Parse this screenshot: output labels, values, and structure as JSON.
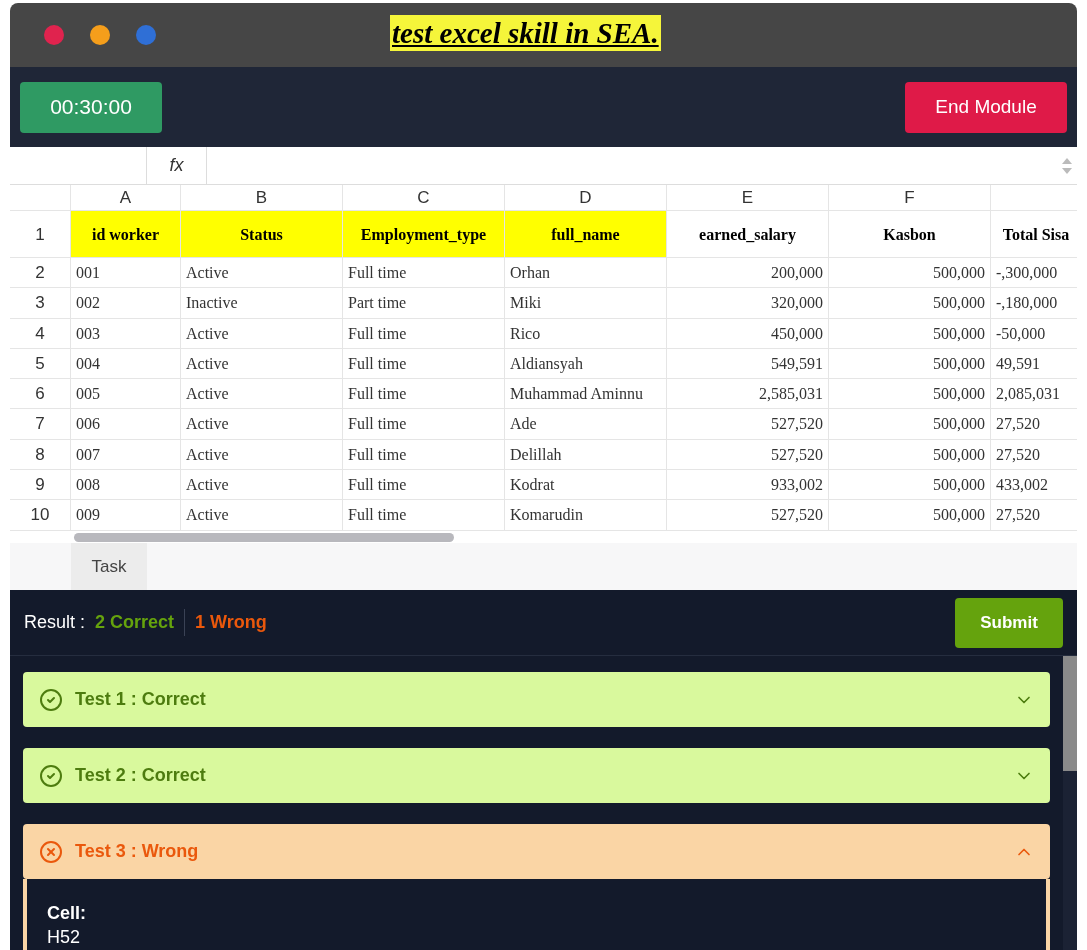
{
  "caption": "test excel skill in SEA.",
  "header": {
    "timer": "00:30:00",
    "end_button": "End Module"
  },
  "formula_bar": {
    "fx": "fx"
  },
  "sheet": {
    "columns": [
      "A",
      "B",
      "C",
      "D",
      "E",
      "F"
    ],
    "header_row": {
      "number": "1",
      "cells": [
        {
          "text": "id worker",
          "highlight": true
        },
        {
          "text": "Status",
          "highlight": true
        },
        {
          "text": "Employment_type",
          "highlight": true
        },
        {
          "text": "full_name",
          "highlight": true
        },
        {
          "text": "earned_salary",
          "highlight": false
        },
        {
          "text": "Kasbon",
          "highlight": false
        },
        {
          "text": "Total Sisa",
          "highlight": false
        }
      ]
    },
    "rows": [
      {
        "number": "2",
        "cells": [
          "001",
          "Active",
          "Full time",
          "Orhan",
          "200,000",
          "500,000",
          "-,300,000"
        ]
      },
      {
        "number": "3",
        "cells": [
          "002",
          "Inactive",
          "Part time",
          "Miki",
          "320,000",
          "500,000",
          "-,180,000"
        ]
      },
      {
        "number": "4",
        "cells": [
          "003",
          "Active",
          "Full time",
          "Rico",
          "450,000",
          "500,000",
          "-50,000"
        ]
      },
      {
        "number": "5",
        "cells": [
          "004",
          "Active",
          "Full time",
          "Aldiansyah",
          "549,591",
          "500,000",
          "49,591"
        ]
      },
      {
        "number": "6",
        "cells": [
          "005",
          "Active",
          "Full time",
          "Muhammad Aminnu",
          "2,585,031",
          "500,000",
          "2,085,031"
        ]
      },
      {
        "number": "7",
        "cells": [
          "006",
          "Active",
          "Full time",
          "Ade",
          "527,520",
          "500,000",
          "27,520"
        ]
      },
      {
        "number": "8",
        "cells": [
          "007",
          "Active",
          "Full time",
          "Delillah",
          "527,520",
          "500,000",
          "27,520"
        ]
      },
      {
        "number": "9",
        "cells": [
          "008",
          "Active",
          "Full time",
          "Kodrat",
          "933,002",
          "500,000",
          "433,002"
        ]
      },
      {
        "number": "10",
        "cells": [
          "009",
          "Active",
          "Full time",
          "Komarudin",
          "527,520",
          "500,000",
          "27,520"
        ]
      }
    ],
    "tabs": [
      {
        "label": "Task",
        "selected": true
      }
    ]
  },
  "result": {
    "label": "Result :",
    "correct": "2 Correct",
    "wrong": "1 Wrong",
    "submit": "Submit"
  },
  "tests": [
    {
      "title": "Test 1 : Correct",
      "kind": "correct",
      "expanded": false
    },
    {
      "title": "Test 2 : Correct",
      "kind": "correct",
      "expanded": false
    },
    {
      "title": "Test 3 : Wrong",
      "kind": "wrong",
      "expanded": true,
      "detail_label": "Cell:",
      "detail_value": "H52"
    }
  ]
}
